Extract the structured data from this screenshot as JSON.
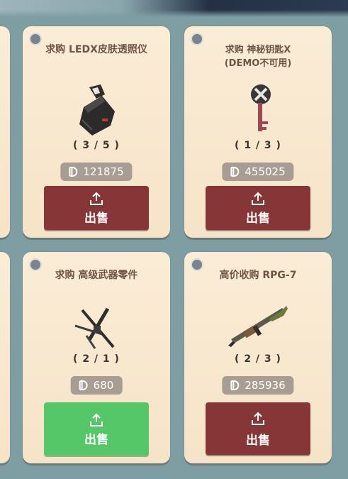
{
  "cards": [
    {
      "title": "求购 LEDX皮肤透照仪",
      "count": "( 3 / 5 )",
      "price": "121875",
      "sell_label": "出售",
      "art_icon": "ledx-icon"
    },
    {
      "title": "求购 神秘钥匙X\n(DEMO不可用)",
      "count": "( 1 / 3 )",
      "price": "455025",
      "sell_label": "出售",
      "art_icon": "key-icon"
    },
    {
      "title": "求购 高级武器零件",
      "count": "( 2 / 1 )",
      "price": "680",
      "sell_label": "出售",
      "art_icon": "weapon-parts-icon"
    },
    {
      "title": "高价收购 RPG-7",
      "count": "( 2 / 3 )",
      "price": "285936",
      "sell_label": "出售",
      "art_icon": "rpg-icon"
    }
  ],
  "colors": {
    "sell_red": "#863637",
    "sell_green": "#55c769",
    "card_bg": "#fbecd6",
    "background": "#7e9ea4"
  }
}
